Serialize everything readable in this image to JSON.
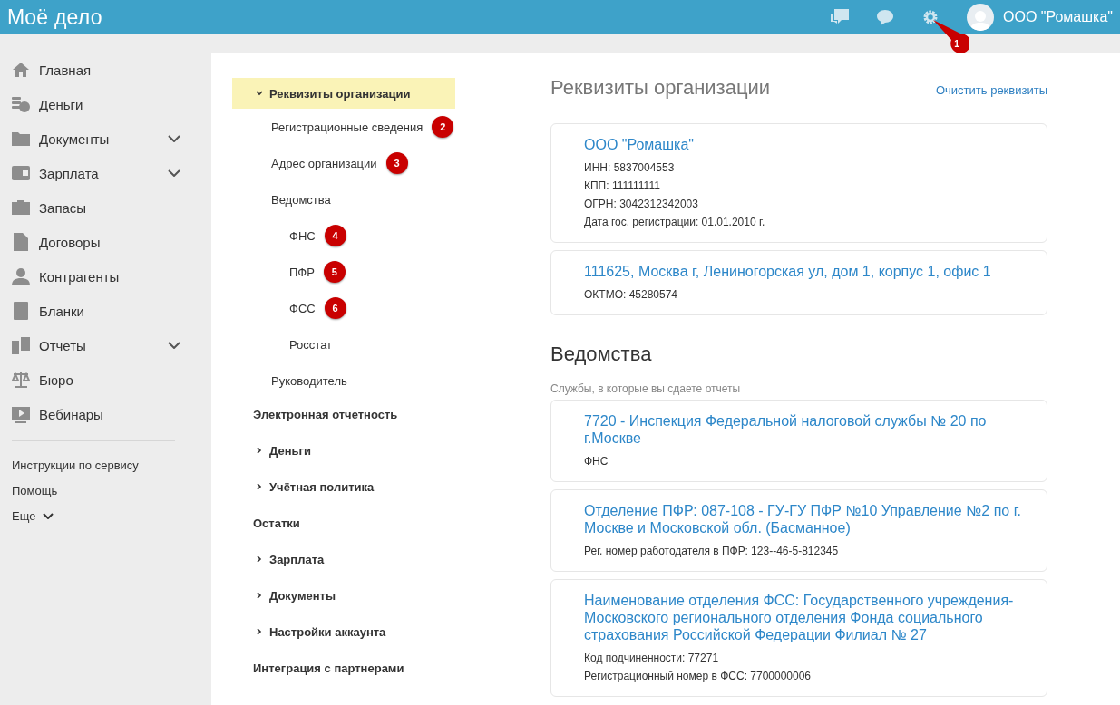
{
  "header": {
    "logo": "Moё дело",
    "company": "ООО \"Ромашка\"",
    "settings_badge": "1"
  },
  "sidebar": {
    "items": [
      {
        "label": "Главная",
        "kind": "link"
      },
      {
        "label": "Деньги",
        "kind": "link"
      },
      {
        "label": "Документы",
        "kind": "menu"
      },
      {
        "label": "Зарплата",
        "kind": "menu"
      },
      {
        "label": "Запасы",
        "kind": "link"
      },
      {
        "label": "Договоры",
        "kind": "link"
      },
      {
        "label": "Контрагенты",
        "kind": "link"
      },
      {
        "label": "Бланки",
        "kind": "link"
      },
      {
        "label": "Отчеты",
        "kind": "menu"
      },
      {
        "label": "Бюро",
        "kind": "link"
      },
      {
        "label": "Вебинары",
        "kind": "link"
      }
    ],
    "footer_links": [
      {
        "label": "Инструкции по сервису",
        "kind": "link"
      },
      {
        "label": "Помощь",
        "kind": "link"
      },
      {
        "label": "Еще",
        "kind": "menu"
      }
    ]
  },
  "settings_nav": [
    {
      "label": "Реквизиты организации",
      "kind": "folder",
      "expanded": true,
      "selected": true,
      "children": [
        {
          "label": "Регистрационные сведения",
          "badge": "2"
        },
        {
          "label": "Адрес организации",
          "badge": "3"
        },
        {
          "label": "Ведомства",
          "children": [
            {
              "label": "ФНС",
              "badge": "4"
            },
            {
              "label": "ПФР",
              "badge": "5"
            },
            {
              "label": "ФСС",
              "badge": "6"
            },
            {
              "label": "Росстат"
            }
          ]
        },
        {
          "label": "Руководитель"
        }
      ]
    },
    {
      "label": "Электронная отчетность",
      "kind": "section",
      "selected": false
    },
    {
      "label": "Деньги",
      "kind": "folder",
      "expanded": false,
      "selected": false
    },
    {
      "label": "Учётная политика",
      "kind": "folder",
      "expanded": false,
      "selected": false
    },
    {
      "label": "Остатки",
      "kind": "section",
      "selected": false
    },
    {
      "label": "Зарплата",
      "kind": "folder",
      "expanded": false,
      "selected": false
    },
    {
      "label": "Документы",
      "kind": "folder",
      "expanded": false,
      "selected": false
    },
    {
      "label": "Настройки аккаунта",
      "kind": "folder",
      "expanded": false,
      "selected": false
    },
    {
      "label": "Интеграция с партнерами",
      "kind": "section",
      "selected": false
    }
  ],
  "content": {
    "title": "Реквизиты организации",
    "clear_link": "Очистить реквизиты",
    "org_cards": [
      {
        "title": "ООО \"Ромашка\"",
        "lines": [
          "ИНН: 5837004553",
          "КПП: 111111111",
          "ОГРН: 3042312342003",
          "Дата гос. регистрации: 01.01.2010 г."
        ]
      },
      {
        "title": "111625, Москва г, Лениногорская ул, дом 1, корпус 1, офис 1",
        "lines": [
          "ОКТМО: 45280574"
        ]
      }
    ],
    "departments_title": "Ведомства",
    "departments_subtitle": "Службы, в которые вы сдаете отчеты",
    "department_cards": [
      {
        "title": "7720 - Инспекция Федеральной налоговой службы № 20 по г.Москве",
        "lines": [
          "ФНС"
        ]
      },
      {
        "title": "Отделение ПФР: 087-108 - ГУ-ГУ ПФР №10 Управление №2 по г. Москве и Московской обл. (Басманное)",
        "lines": [
          "Рег. номер работодателя в ПФР: 123--46-5-812345"
        ]
      },
      {
        "title": "Наименование отделения ФСС: Государственного учреждения-Московского регионального отделения Фонда социального страхования Российской Федерации Филиал № 27",
        "lines": [
          "Код подчиненности: 77271",
          "Регистрационный номер в ФСС: 7700000006"
        ]
      }
    ]
  }
}
